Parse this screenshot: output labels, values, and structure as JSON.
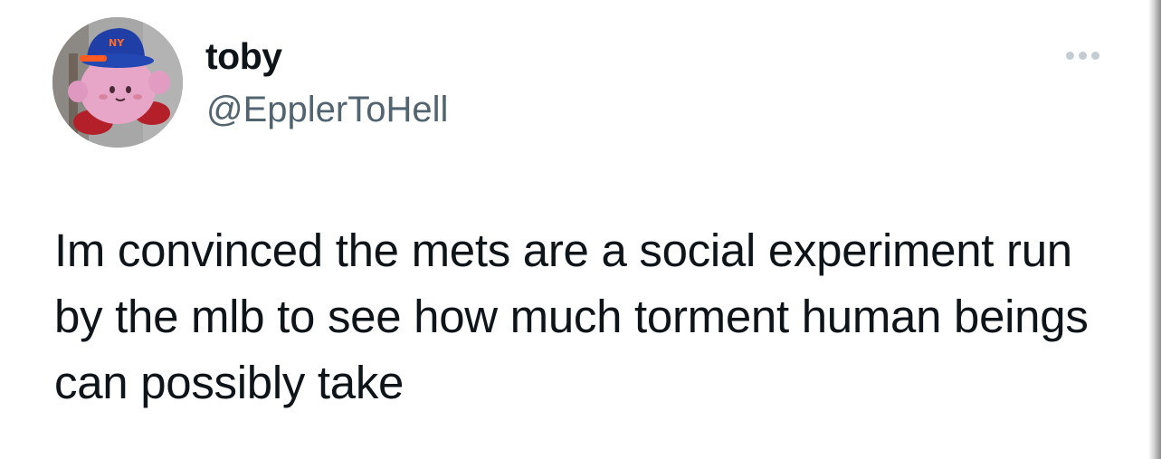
{
  "author": {
    "name": "toby",
    "handle": "@EpplerToHell",
    "avatar": "kirby-plush-mets-cap-avatar"
  },
  "more_icon": "more-horizontal-icon",
  "tweet": {
    "text": "Im convinced the mets are a social experiment run by the mlb to see how much torment human beings can possibly take"
  },
  "colors": {
    "text": "#0f1419",
    "secondary_text": "#536471",
    "icon_gray": "#c4ccd2",
    "background": "#ffffff"
  }
}
